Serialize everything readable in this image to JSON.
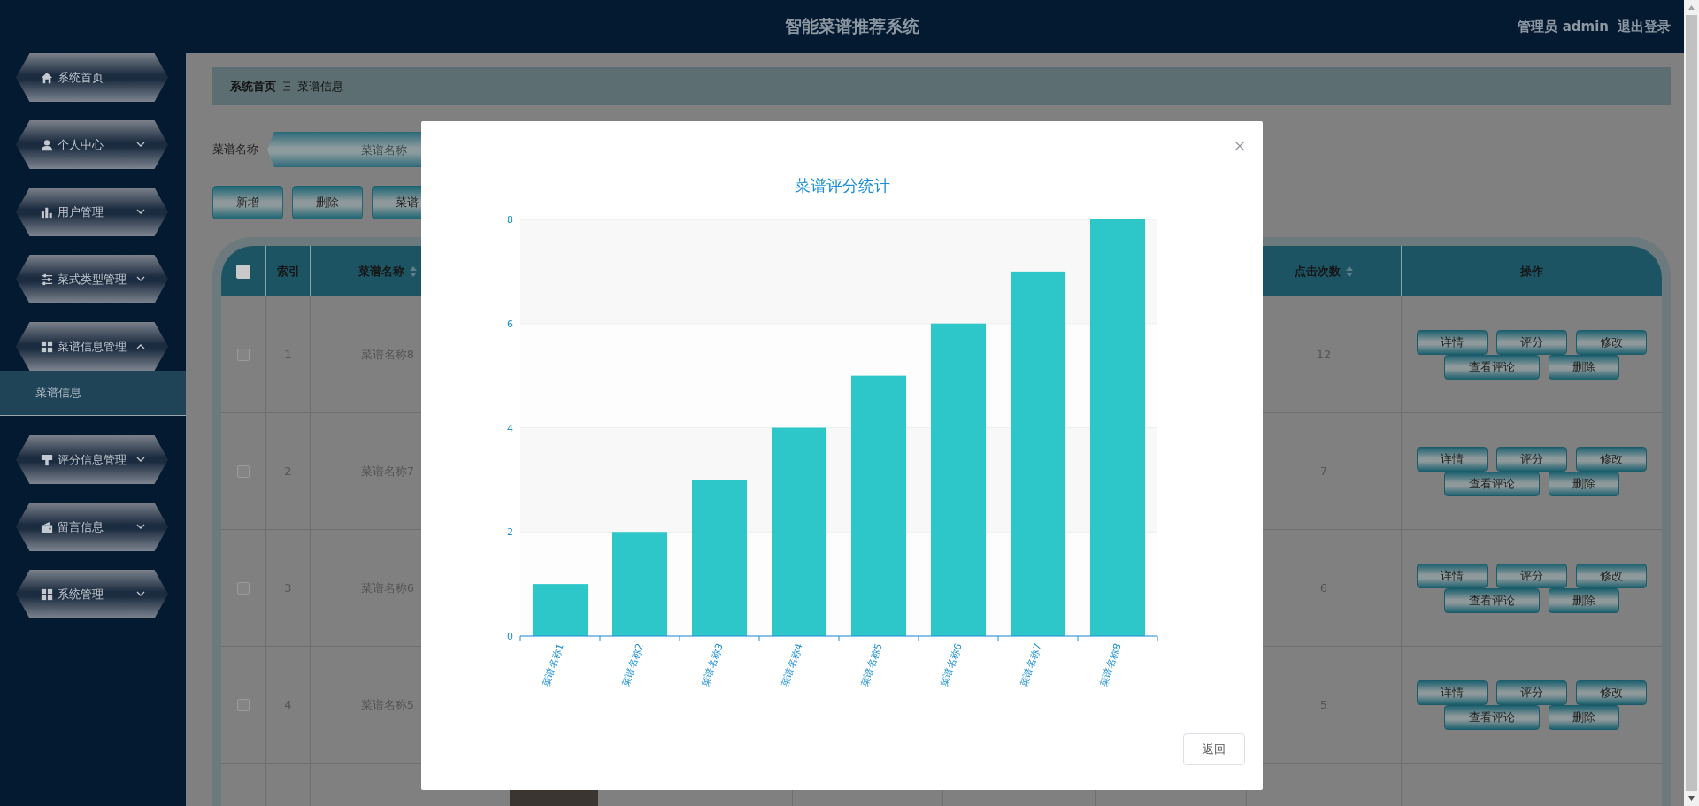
{
  "header": {
    "title": "智能菜谱推荐系统",
    "user": "管理员 admin",
    "logout": "退出登录"
  },
  "sidebar": {
    "items": [
      {
        "label": "系统首页"
      },
      {
        "label": "个人中心",
        "expanded": false
      },
      {
        "label": "用户管理",
        "expanded": false
      },
      {
        "label": "菜式类型管理",
        "expanded": false
      },
      {
        "label": "菜谱信息管理",
        "expanded": true,
        "children": [
          {
            "label": "菜谱信息",
            "selected": true
          }
        ]
      },
      {
        "label": "评分信息管理",
        "expanded": false
      },
      {
        "label": "留言信息",
        "expanded": false
      },
      {
        "label": "系统管理",
        "expanded": false
      }
    ]
  },
  "breadcrumb": [
    {
      "label": "系统首页"
    },
    {
      "label": "菜谱信息"
    }
  ],
  "search": {
    "label": "菜谱名称",
    "placeholder": "菜谱名称"
  },
  "toolbar": [
    "新增",
    "删除",
    "菜谱"
  ],
  "table": {
    "select_all": {
      "checked": false
    },
    "columns": [
      {
        "label": "索引",
        "sortable": false
      },
      {
        "label": "菜谱名称",
        "sortable": true
      },
      {
        "label": "点击次数",
        "sortable": true
      },
      {
        "label": "操作",
        "sortable": false
      }
    ],
    "rows": [
      {
        "checked": false,
        "index": "1",
        "name": "菜谱名称8",
        "clicks": "12",
        "actions": [
          "详情",
          "评分",
          "修改",
          "查看评论",
          "删除"
        ]
      },
      {
        "checked": false,
        "index": "2",
        "name": "菜谱名称7",
        "clicks": "7",
        "actions": [
          "详情",
          "评分",
          "修改",
          "查看评论",
          "删除"
        ]
      },
      {
        "checked": false,
        "index": "3",
        "name": "菜谱名称6",
        "clicks": "6",
        "actions": [
          "详情",
          "评分",
          "修改",
          "查看评论",
          "删除"
        ]
      },
      {
        "checked": false,
        "index": "4",
        "name": "菜谱名称5",
        "clicks": "5",
        "actions": [
          "详情",
          "评分",
          "修改",
          "查看评论",
          "删除"
        ]
      }
    ]
  },
  "modal": {
    "chart_data": {
      "type": "bar",
      "title": "菜谱评分统计",
      "categories": [
        "菜谱名称1",
        "菜谱名称2",
        "菜谱名称3",
        "菜谱名称4",
        "菜谱名称5",
        "菜谱名称6",
        "菜谱名称7",
        "菜谱名称8"
      ],
      "values": [
        1,
        2,
        3,
        4,
        5,
        6,
        7,
        8
      ],
      "ylim": [
        0,
        8
      ],
      "yticks": [
        0,
        2,
        4,
        6,
        8
      ],
      "grid": true
    },
    "buttons": [
      "返回"
    ]
  }
}
